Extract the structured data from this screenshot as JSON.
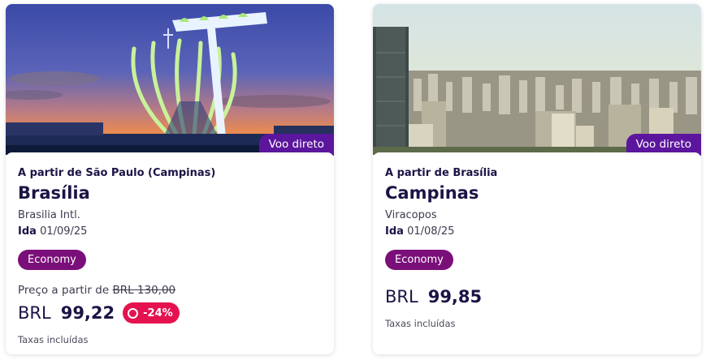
{
  "colors": {
    "badge": "#5c169d",
    "cabin": "#7b0f7a",
    "discount": "#e4134f",
    "text": "#1b1446"
  },
  "cards": [
    {
      "image_alt": "Catedral de Brasília iluminada ao entardecer",
      "badge": "Voo direto",
      "origin": "A partir de São Paulo (Campinas)",
      "destination": "Brasília",
      "airport": "Brasilia Intl.",
      "date_label": "Ida",
      "date": "01/09/25",
      "cabin": "Economy",
      "from_label": "Preço a partir de",
      "old_price": "BRL 130,00",
      "currency": "BRL",
      "price": "99,22",
      "discount": "-24%",
      "taxes": "Taxas incluídas"
    },
    {
      "image_alt": "Vista aérea de prédios em Campinas",
      "badge": "Voo direto",
      "origin": "A partir de Brasília",
      "destination": "Campinas",
      "airport": "Viracopos",
      "date_label": "Ida",
      "date": "01/08/25",
      "cabin": "Economy",
      "currency": "BRL",
      "price": "99,85",
      "taxes": "Taxas incluídas"
    }
  ]
}
